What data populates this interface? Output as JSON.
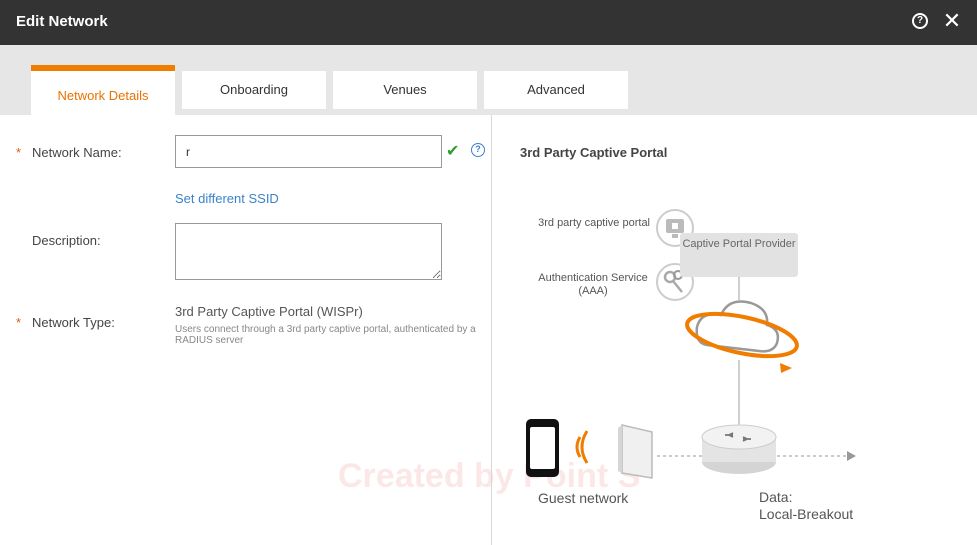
{
  "window": {
    "title": "Edit Network",
    "help_icon": "?",
    "close_icon": "✕"
  },
  "tabs": [
    {
      "label": "Network Details",
      "active": true
    },
    {
      "label": "Onboarding",
      "active": false
    },
    {
      "label": "Venues",
      "active": false
    },
    {
      "label": "Advanced",
      "active": false
    }
  ],
  "form": {
    "required_mark": "*",
    "network_name_label": "Network Name:",
    "network_name_value": "r",
    "check_icon": "✔",
    "help_icon": "?",
    "set_ssid_link": "Set different SSID",
    "description_label": "Description:",
    "description_value": "",
    "network_type_label": "Network Type:",
    "network_type_value": "3rd Party Captive Portal (WISPr)",
    "network_type_desc": "Users connect through a 3rd party captive portal, authenticated by a RADIUS server"
  },
  "diagram": {
    "title": "3rd Party Captive Portal",
    "captive_portal_label": "3rd party captive portal",
    "auth_service_label": "Authentication Service (AAA)",
    "provider_box": "Captive Portal Provider",
    "guest_label": "Guest network",
    "data_label_1": "Data:",
    "data_label_2": "Local-Breakout",
    "watermark": "Created by Point S"
  },
  "colors": {
    "accent": "#f07d00",
    "link": "#3b83c7",
    "success": "#2e9e2e",
    "titlebar": "#333333"
  }
}
